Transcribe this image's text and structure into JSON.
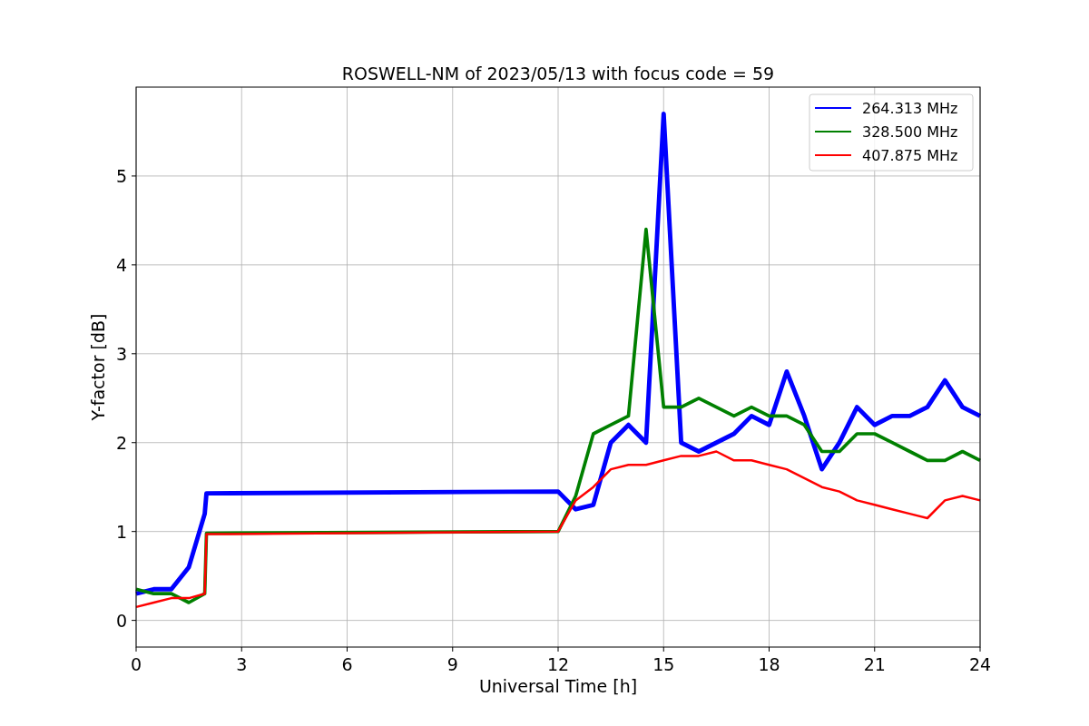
{
  "figure": {
    "chart_data": {
      "type": "line",
      "title": "ROSWELL-NM of 2023/05/13 with focus code = 59",
      "xlabel": "Universal Time [h]",
      "ylabel": "Y-factor [dB]",
      "x": [
        0,
        0.5,
        1,
        1.5,
        1.95,
        2,
        12,
        12.5,
        13,
        13.5,
        14,
        14.5,
        15,
        15.5,
        16,
        16.5,
        17,
        17.5,
        18,
        18.5,
        19,
        19.5,
        20,
        20.5,
        21,
        21.5,
        22,
        22.5,
        23,
        23.5,
        24
      ],
      "series": [
        {
          "name": "264.313 MHz",
          "color": "#0000ff",
          "values": [
            0.3,
            0.35,
            0.35,
            0.6,
            1.2,
            1.43,
            1.45,
            1.25,
            1.3,
            2.0,
            2.2,
            2.0,
            5.7,
            2.0,
            1.9,
            2.0,
            2.1,
            2.3,
            2.2,
            2.8,
            2.3,
            1.7,
            2.0,
            2.4,
            2.2,
            2.3,
            2.3,
            2.4,
            2.7,
            2.4,
            2.3
          ]
        },
        {
          "name": "328.500 MHz",
          "color": "#008000",
          "values": [
            0.35,
            0.3,
            0.3,
            0.2,
            0.3,
            0.98,
            1.0,
            1.4,
            2.1,
            2.2,
            2.3,
            4.4,
            2.4,
            2.4,
            2.5,
            2.4,
            2.3,
            2.4,
            2.3,
            2.3,
            2.2,
            1.9,
            1.9,
            2.1,
            2.1,
            2.0,
            1.9,
            1.8,
            1.8,
            1.9,
            1.8
          ]
        },
        {
          "name": "407.875 MHz",
          "color": "#ff0000",
          "values": [
            0.15,
            0.2,
            0.25,
            0.25,
            0.3,
            0.97,
            1.0,
            1.35,
            1.5,
            1.7,
            1.75,
            1.75,
            1.8,
            1.85,
            1.85,
            1.9,
            1.8,
            1.8,
            1.75,
            1.7,
            1.6,
            1.5,
            1.45,
            1.35,
            1.3,
            1.25,
            1.2,
            1.15,
            1.35,
            1.4,
            1.35
          ]
        }
      ],
      "xlim": [
        0,
        24
      ],
      "ylim": [
        -0.3,
        6.0
      ],
      "xticks": [
        0,
        3,
        6,
        9,
        12,
        15,
        18,
        21,
        24
      ],
      "yticks": [
        0,
        1,
        2,
        3,
        4,
        5
      ],
      "grid": true,
      "legend": true
    }
  }
}
